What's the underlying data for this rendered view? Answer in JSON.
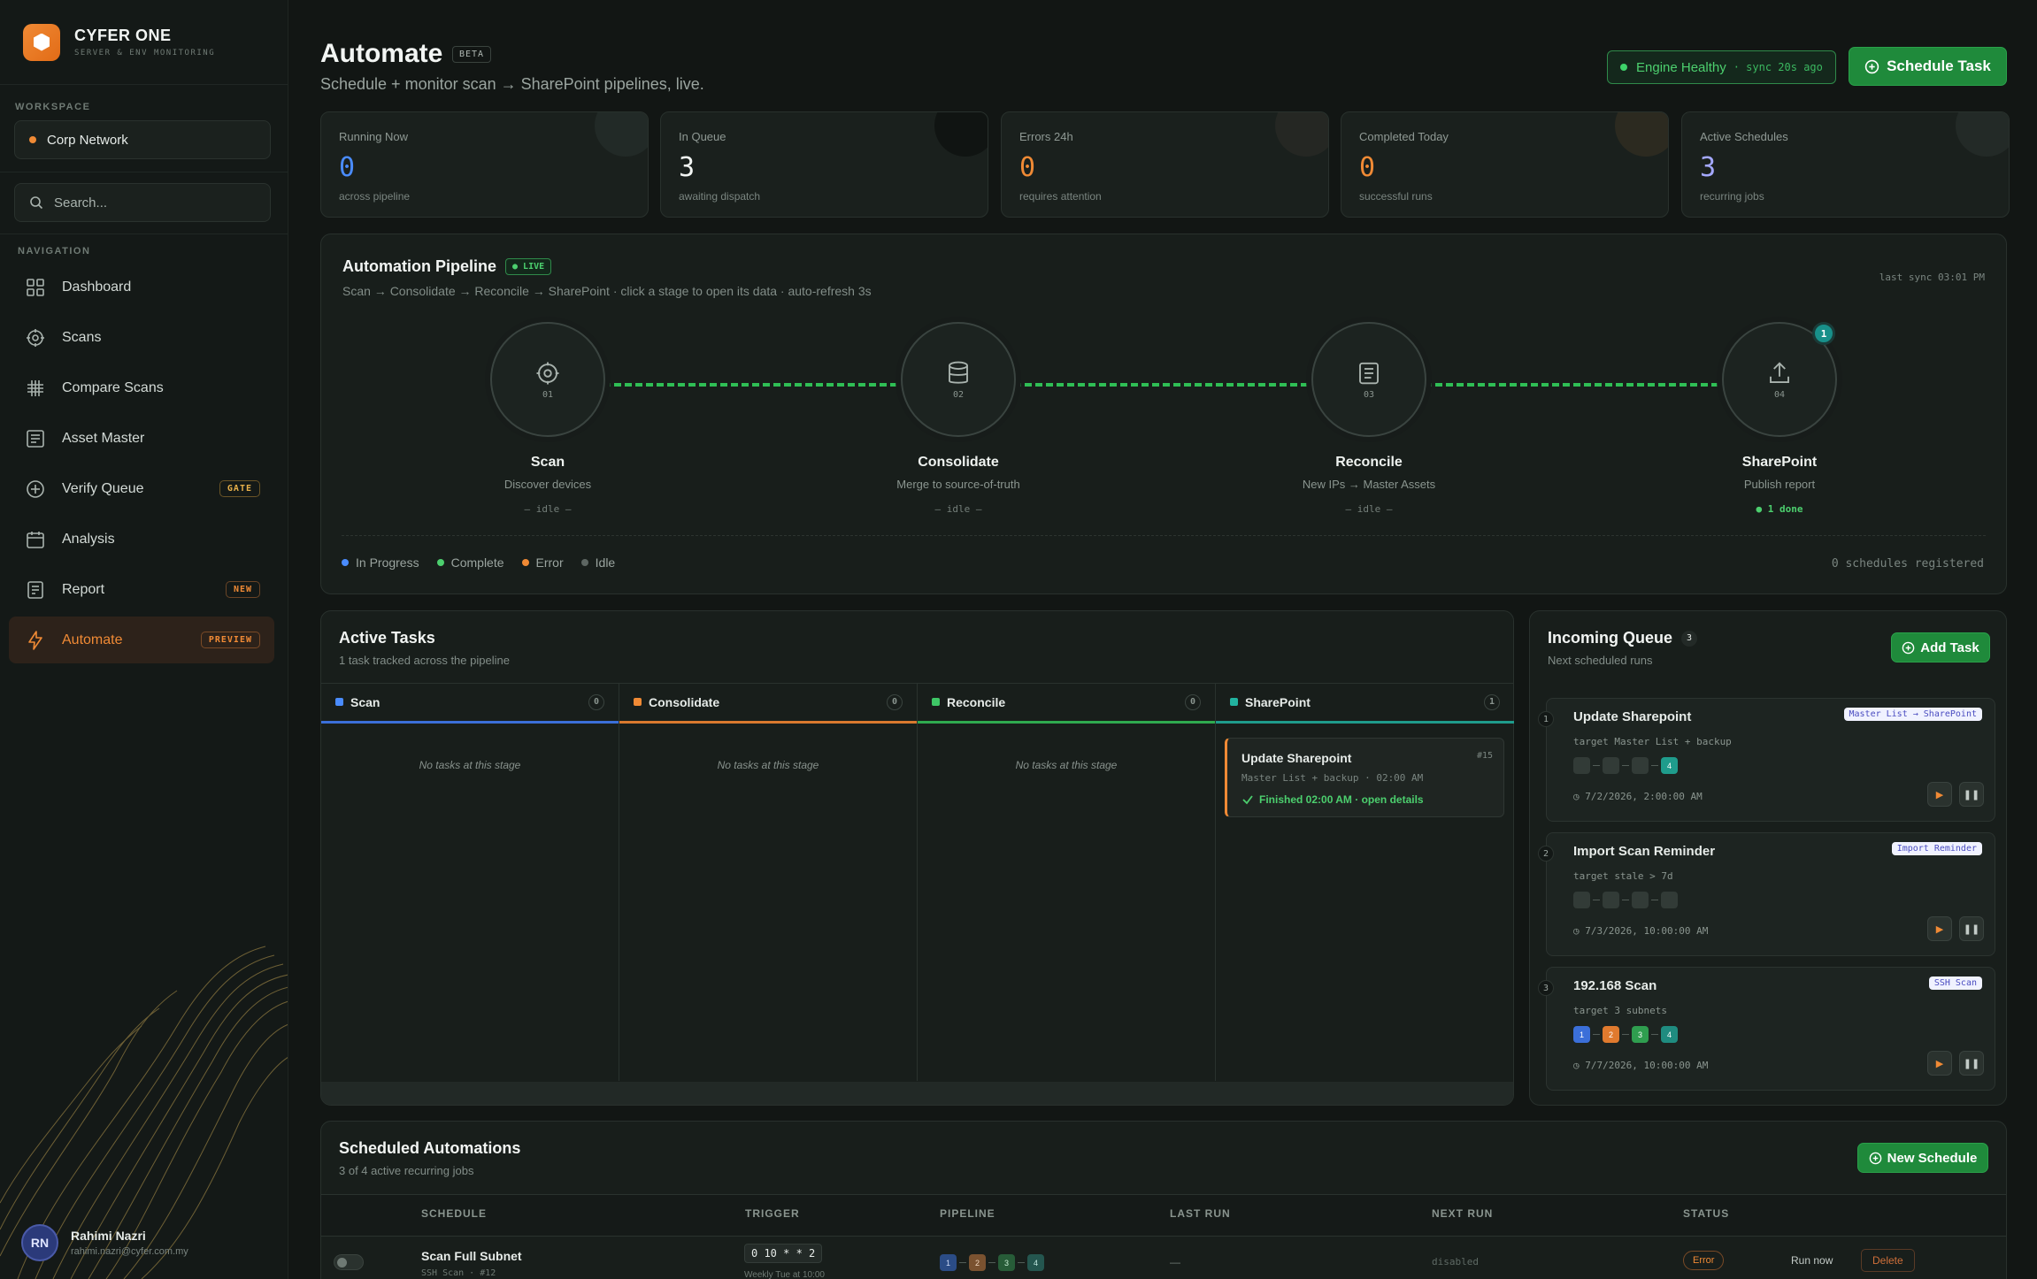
{
  "brand": {
    "name": "CYFER ONE",
    "sub": "SERVER & ENV MONITORING"
  },
  "workspace": {
    "label": "WORKSPACE",
    "name": "Corp Network"
  },
  "search": {
    "placeholder": "Search..."
  },
  "nav": {
    "label": "NAVIGATION",
    "items": [
      {
        "label": "Dashboard",
        "icon": "grid-icon"
      },
      {
        "label": "Scans",
        "icon": "crosshair-icon"
      },
      {
        "label": "Compare Scans",
        "icon": "hash-icon"
      },
      {
        "label": "Asset Master",
        "icon": "list-icon"
      },
      {
        "label": "Verify Queue",
        "icon": "plus-circle-icon",
        "badge": "GATE"
      },
      {
        "label": "Analysis",
        "icon": "calendar-icon"
      },
      {
        "label": "Report",
        "icon": "document-icon",
        "badge": "NEW"
      },
      {
        "label": "Automate",
        "icon": "lightning-icon",
        "badge": "PREVIEW"
      }
    ]
  },
  "user": {
    "initials": "RN",
    "name": "Rahimi Nazri",
    "email": "rahimi.nazri@cyfer.com.my"
  },
  "header": {
    "title": "Automate",
    "badge": "BETA",
    "subtitle": "Schedule + monitor scan → SharePoint pipelines, live.",
    "health": "Engine Healthy",
    "sync": "· sync 20s ago",
    "schedule_btn": "Schedule Task"
  },
  "stats": [
    {
      "label": "Running Now",
      "value": "0",
      "sub": "across pipeline",
      "color": "#4a8cff"
    },
    {
      "label": "In Queue",
      "value": "3",
      "sub": "awaiting dispatch",
      "color": "#f2f5f3"
    },
    {
      "label": "Errors 24h",
      "value": "0",
      "sub": "requires attention",
      "color": "#f08a35"
    },
    {
      "label": "Completed Today",
      "value": "0",
      "sub": "successful runs",
      "color": "#f08a35"
    },
    {
      "label": "Active Schedules",
      "value": "3",
      "sub": "recurring jobs",
      "color": "#a4a8ff"
    }
  ],
  "pipeline": {
    "title": "Automation Pipeline",
    "live": "● LIVE",
    "sub": "Scan → Consolidate → Reconcile → SharePoint · click a stage to open its data · auto-refresh 3s",
    "last_sync": "last sync 03:01 PM",
    "stages": [
      {
        "num": "01",
        "name": "Scan",
        "desc": "Discover devices",
        "state": "— idle —"
      },
      {
        "num": "02",
        "name": "Consolidate",
        "desc": "Merge to source-of-truth",
        "state": "— idle —"
      },
      {
        "num": "03",
        "name": "Reconcile",
        "desc": "New IPs → Master Assets",
        "state": "— idle —"
      },
      {
        "num": "04",
        "name": "SharePoint",
        "desc": "Publish report",
        "state": "● 1 done",
        "count": "1"
      }
    ],
    "legend": [
      "In Progress",
      "Complete",
      "Error",
      "Idle"
    ],
    "schedules": "0 schedules registered"
  },
  "tasks": {
    "title": "Active Tasks",
    "sub": "1 task tracked across the pipeline",
    "columns": [
      {
        "name": "Scan",
        "count": "0",
        "empty": "No tasks at this stage"
      },
      {
        "name": "Consolidate",
        "count": "0",
        "empty": "No tasks at this stage"
      },
      {
        "name": "Reconcile",
        "count": "0",
        "empty": "No tasks at this stage"
      },
      {
        "name": "SharePoint",
        "count": "1"
      }
    ],
    "card": {
      "title": "Update Sharepoint",
      "id": "#15",
      "meta": "Master List + backup · 02:00 AM",
      "status": "Finished 02:00 AM · open details"
    }
  },
  "queue": {
    "title": "Incoming Queue",
    "count": "3",
    "sub": "Next scheduled runs",
    "add_btn": "Add Task",
    "items": [
      {
        "num": "1",
        "title": "Update Sharepoint",
        "tag": "Master List → SharePoint",
        "target": "target Master List + backup",
        "time": "7/2/2026, 2:00:00 AM",
        "step4": "4"
      },
      {
        "num": "2",
        "title": "Import Scan Reminder",
        "tag": "Import Reminder",
        "target": "target stale > 7d",
        "time": "7/3/2026, 10:00:00 AM"
      },
      {
        "num": "3",
        "title": "192.168 Scan",
        "tag": "SSH Scan",
        "target": "target 3 subnets",
        "time": "7/7/2026, 10:00:00 AM",
        "steps": [
          "1",
          "2",
          "3",
          "4"
        ]
      }
    ]
  },
  "scheduled": {
    "title": "Scheduled Automations",
    "sub": "3 of 4 active recurring jobs",
    "new_btn": "New Schedule",
    "headers": [
      "SCHEDULE",
      "TRIGGER",
      "PIPELINE",
      "LAST RUN",
      "NEXT RUN",
      "STATUS"
    ],
    "row": {
      "name": "Scan Full Subnet",
      "meta": "SSH Scan · #12",
      "cron": "0 10 * * 2",
      "cron_desc": "Weekly Tue at 10:00",
      "steps": [
        "1",
        "2",
        "3",
        "4"
      ],
      "last": "—",
      "next": "disabled",
      "status": "Error",
      "run": "Run now",
      "delete": "Delete"
    }
  }
}
